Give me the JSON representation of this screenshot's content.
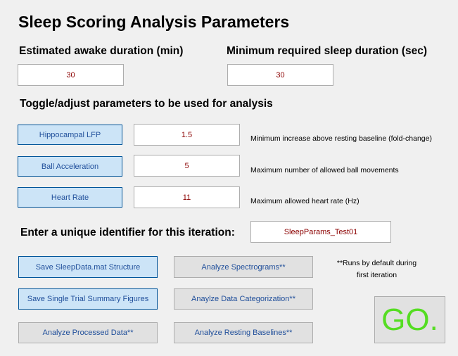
{
  "title": "Sleep Scoring Analysis Parameters",
  "awake": {
    "label": "Estimated awake duration (min)",
    "value": "30"
  },
  "min_sleep": {
    "label": "Minimum required sleep duration (sec)",
    "value": "30"
  },
  "toggle_heading": "Toggle/adjust parameters to be used for analysis",
  "params": [
    {
      "button": "Hippocampal LFP",
      "value": "1.5",
      "desc": "Minimum increase above resting baseline (fold-change)"
    },
    {
      "button": "Ball Acceleration",
      "value": "5",
      "desc": "Maximum number of allowed ball movements"
    },
    {
      "button": "Heart Rate",
      "value": "11",
      "desc": "Maximum allowed heart rate (Hz)"
    }
  ],
  "identifier": {
    "label": "Enter a unique identifier for this iteration:",
    "value": "SleepParams_Test01"
  },
  "actions": {
    "save_sleepdata": "Save SleepData.mat Structure",
    "save_single_trial": "Save Single Trial Summary Figures",
    "analyze_processed": "Analyze Processed Data**",
    "analyze_spectrograms": "Analyze  Spectrograms**",
    "analyze_categorization": "Anaylze Data Categorization**",
    "analyze_resting": "Analyze Resting Baselines**"
  },
  "note": {
    "line1": "**Runs by default during",
    "line2": "first iteration"
  },
  "go_label": "GO.",
  "colors": {
    "background": "#f0f0f0",
    "selected_button": "#cce4f7",
    "field_text": "#8b0000",
    "go_text": "#55dd22"
  }
}
